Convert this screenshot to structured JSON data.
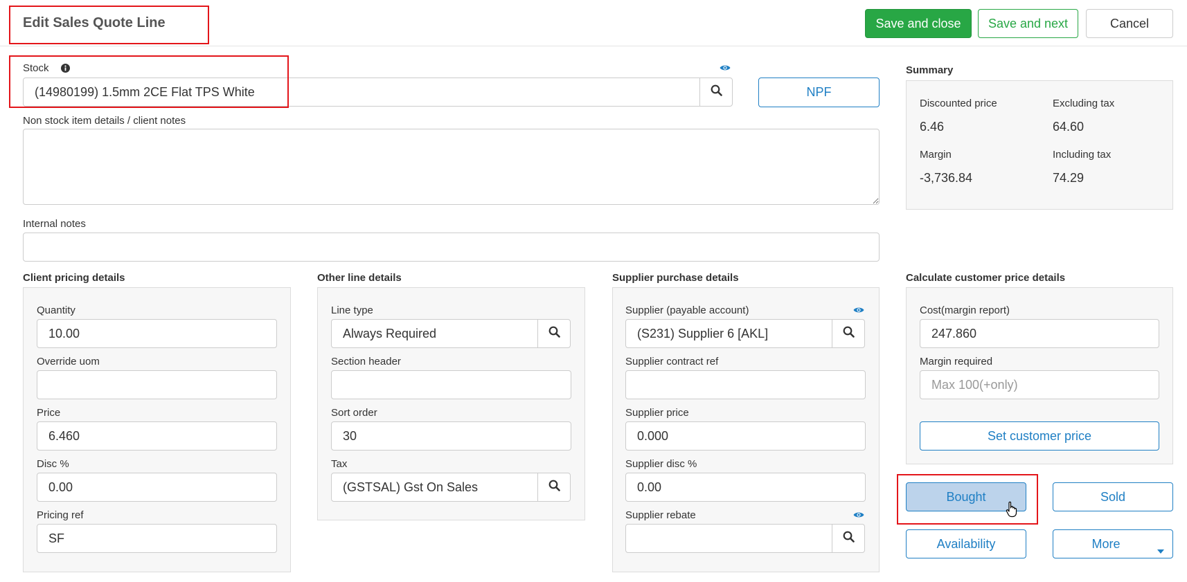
{
  "header": {
    "title": "Edit Sales Quote Line",
    "save_close_label": "Save and close",
    "save_next_label": "Save and next",
    "cancel_label": "Cancel"
  },
  "stock": {
    "label": "Stock",
    "value": "(14980199) 1.5mm 2CE Flat TPS White",
    "npf_label": "NPF"
  },
  "notes": {
    "non_stock_label": "Non stock item details / client notes",
    "non_stock_value": "",
    "internal_label": "Internal notes",
    "internal_value": ""
  },
  "summary": {
    "title": "Summary",
    "discounted_price_label": "Discounted price",
    "discounted_price": "6.46",
    "excluding_tax_label": "Excluding tax",
    "excluding_tax": "64.60",
    "margin_label": "Margin",
    "margin": "-3,736.84",
    "including_tax_label": "Including tax",
    "including_tax": "74.29"
  },
  "client_pricing": {
    "title": "Client pricing details",
    "quantity_label": "Quantity",
    "quantity": "10.00",
    "override_uom_label": "Override uom",
    "override_uom": "",
    "price_label": "Price",
    "price": "6.460",
    "disc_label": "Disc %",
    "disc": "0.00",
    "pricing_ref_label": "Pricing ref",
    "pricing_ref": "SF"
  },
  "other_line": {
    "title": "Other line details",
    "line_type_label": "Line type",
    "line_type": "Always Required",
    "section_header_label": "Section header",
    "section_header": "",
    "sort_order_label": "Sort order",
    "sort_order": "30",
    "tax_label": "Tax",
    "tax": "(GSTSAL) Gst On Sales"
  },
  "supplier_purchase": {
    "title": "Supplier purchase details",
    "supplier_label": "Supplier (payable account)",
    "supplier": "(S231) Supplier 6 [AKL]",
    "contract_ref_label": "Supplier contract ref",
    "contract_ref": "",
    "supplier_price_label": "Supplier price",
    "supplier_price": "0.000",
    "supplier_disc_label": "Supplier disc %",
    "supplier_disc": "0.00",
    "supplier_rebate_label": "Supplier rebate",
    "supplier_rebate": ""
  },
  "calc_price": {
    "title": "Calculate customer price details",
    "cost_label": "Cost(margin report)",
    "cost": "247.860",
    "margin_required_label": "Margin required",
    "margin_required_placeholder": "Max 100(+only)",
    "set_price_label": "Set customer price"
  },
  "actions": {
    "bought_label": "Bought",
    "sold_label": "Sold",
    "availability_label": "Availability",
    "more_label": "More"
  },
  "colors": {
    "primary_green": "#28a745",
    "link_blue": "#1f7fc4",
    "highlight_red": "#e3151a",
    "active_blue_bg": "#bcd3eb"
  }
}
